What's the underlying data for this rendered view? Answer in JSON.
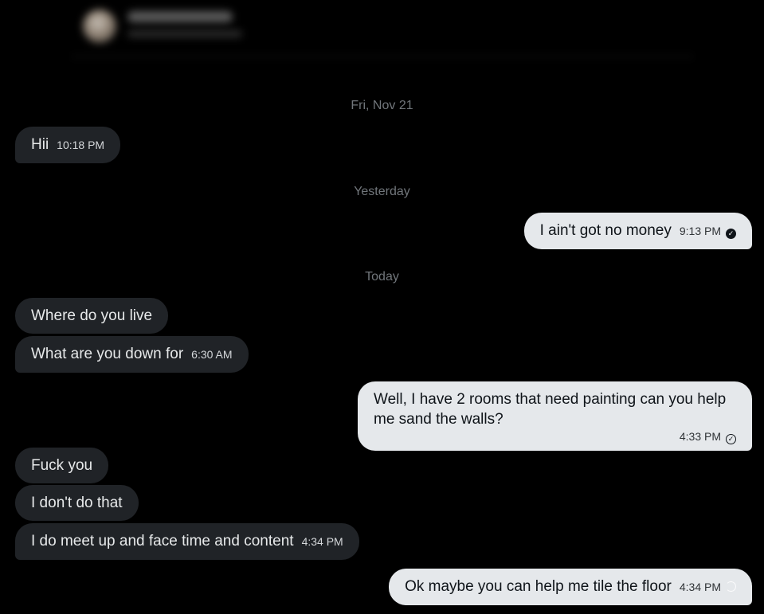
{
  "header": {
    "contact_name": "",
    "contact_handle": ""
  },
  "date_separators": [
    "Fri, Nov 21",
    "Yesterday",
    "Today"
  ],
  "messages": [
    {
      "direction": "incoming",
      "text": "Hii",
      "time": "10:18 PM"
    },
    {
      "direction": "outgoing",
      "text": "I ain't got no money",
      "time": "9:13 PM",
      "status": "read"
    },
    {
      "direction": "incoming",
      "text": "Where do you live",
      "time": ""
    },
    {
      "direction": "incoming",
      "text": "What are you down for",
      "time": "6:30 AM"
    },
    {
      "direction": "outgoing",
      "text": "Well, I have 2 rooms that need painting can you help me sand the walls?",
      "time": "4:33 PM",
      "status": "sent"
    },
    {
      "direction": "incoming",
      "text": "Fuck you",
      "time": ""
    },
    {
      "direction": "incoming",
      "text": "I don't do that",
      "time": ""
    },
    {
      "direction": "incoming",
      "text": "I do meet up and face time and content",
      "time": "4:34 PM"
    },
    {
      "direction": "outgoing",
      "text": "Ok maybe you can help me tile the floor",
      "time": "4:34 PM",
      "status": "sending"
    }
  ],
  "colors": {
    "background": "#000000",
    "incoming_bubble": "#202327",
    "outgoing_bubble": "#e5e8eb",
    "date_separator": "#71767b"
  },
  "icons": {
    "read": "check-circle-filled-icon",
    "sent": "check-circle-outline-icon",
    "sending": "sending-spinner-icon"
  }
}
